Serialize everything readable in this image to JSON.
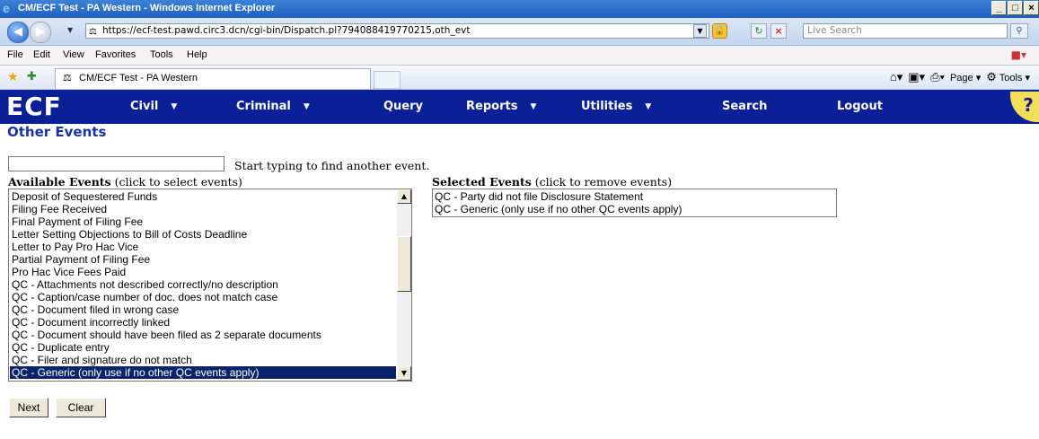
{
  "window": {
    "title": "CM/ECF Test - PA Western - Windows Internet Explorer",
    "minimize": "_",
    "maximize": "□",
    "close": "×"
  },
  "address": {
    "url": "https://ecf-test.pawd.circ3.dcn/cgi-bin/Dispatch.pl?794088419770215,oth_evt",
    "search_placeholder": "Live Search"
  },
  "menu": [
    "File",
    "Edit",
    "View",
    "Favorites",
    "Tools",
    "Help"
  ],
  "tab": {
    "label": "CM/ECF Test - PA Western"
  },
  "commandbar": {
    "page": "Page",
    "tools": "Tools"
  },
  "ecf": {
    "logo": "ECF",
    "nav": [
      {
        "label": "Civil",
        "has_menu": true
      },
      {
        "label": "Criminal",
        "has_menu": true
      },
      {
        "label": "Query",
        "has_menu": false
      },
      {
        "label": "Reports",
        "has_menu": true
      },
      {
        "label": "Utilities",
        "has_menu": true
      },
      {
        "label": "Search",
        "has_menu": false
      },
      {
        "label": "Logout",
        "has_menu": false
      }
    ]
  },
  "page": {
    "title": "Other Events",
    "finder_hint": "Start typing to find another event.",
    "available_label_bold": "Available Events",
    "available_label_rest": " (click to select events)",
    "selected_label_bold": "Selected Events",
    "selected_label_rest": " (click to remove events)",
    "available_events": [
      "Deposit of Sequestered Funds",
      "Filing Fee Received",
      "Final Payment of Filing Fee",
      "Letter Setting Objections to Bill of Costs Deadline",
      "Letter to Pay Pro Hac Vice",
      "Partial Payment of Filing Fee",
      "Pro Hac Vice Fees Paid",
      "QC - Attachments not described correctly/no description",
      "QC - Caption/case number of doc. does not match case",
      "QC - Document filed in wrong case",
      "QC - Document incorrectly linked",
      "QC - Document should have been filed as 2 separate documents",
      "QC - Duplicate entry",
      "QC - Filer and signature do not match",
      "QC - Generic (only use if no other QC events apply)"
    ],
    "highlighted_index": 14,
    "selected_events": [
      "QC - Party did not file Disclosure Statement",
      "QC - Generic (only use if no other QC events apply)"
    ],
    "buttons": {
      "next": "Next",
      "clear": "Clear"
    }
  }
}
